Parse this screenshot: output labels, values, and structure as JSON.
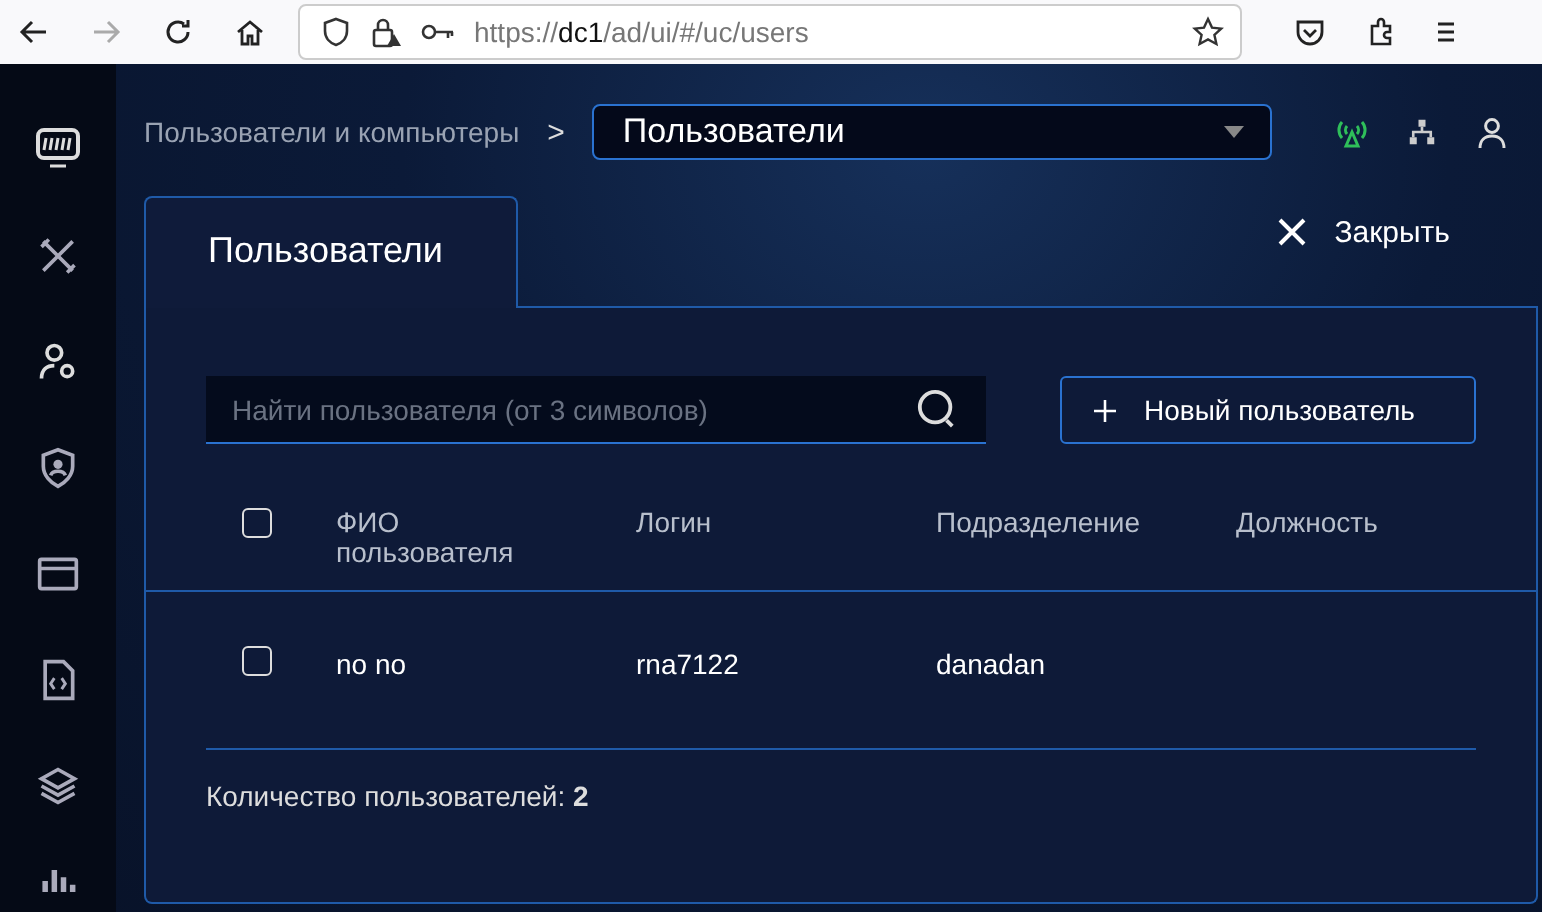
{
  "browser": {
    "url_prefix": "https://",
    "url_host": "dc1",
    "url_path": "/ad/ui/#/uc/users"
  },
  "header": {
    "breadcrumb": "Пользователи и компьютеры",
    "separator": ">",
    "section_select": {
      "value": "Пользователи"
    }
  },
  "tab": {
    "label": "Пользователи",
    "selected": true
  },
  "close_button": {
    "label": "Закрыть"
  },
  "search": {
    "placeholder": "Найти пользователя (от 3 символов)"
  },
  "new_user_button": {
    "label": "Новый пользователь"
  },
  "table": {
    "select_all_checked": false,
    "columns": [
      "ФИО пользователя",
      "Логин",
      "Подразделение",
      "Должность"
    ],
    "rows": [
      {
        "checked": false,
        "cells": [
          "no no",
          "rna7122",
          "danadan",
          ""
        ]
      }
    ]
  },
  "footer": {
    "count_text": "Количество пользователей: **2**"
  }
}
